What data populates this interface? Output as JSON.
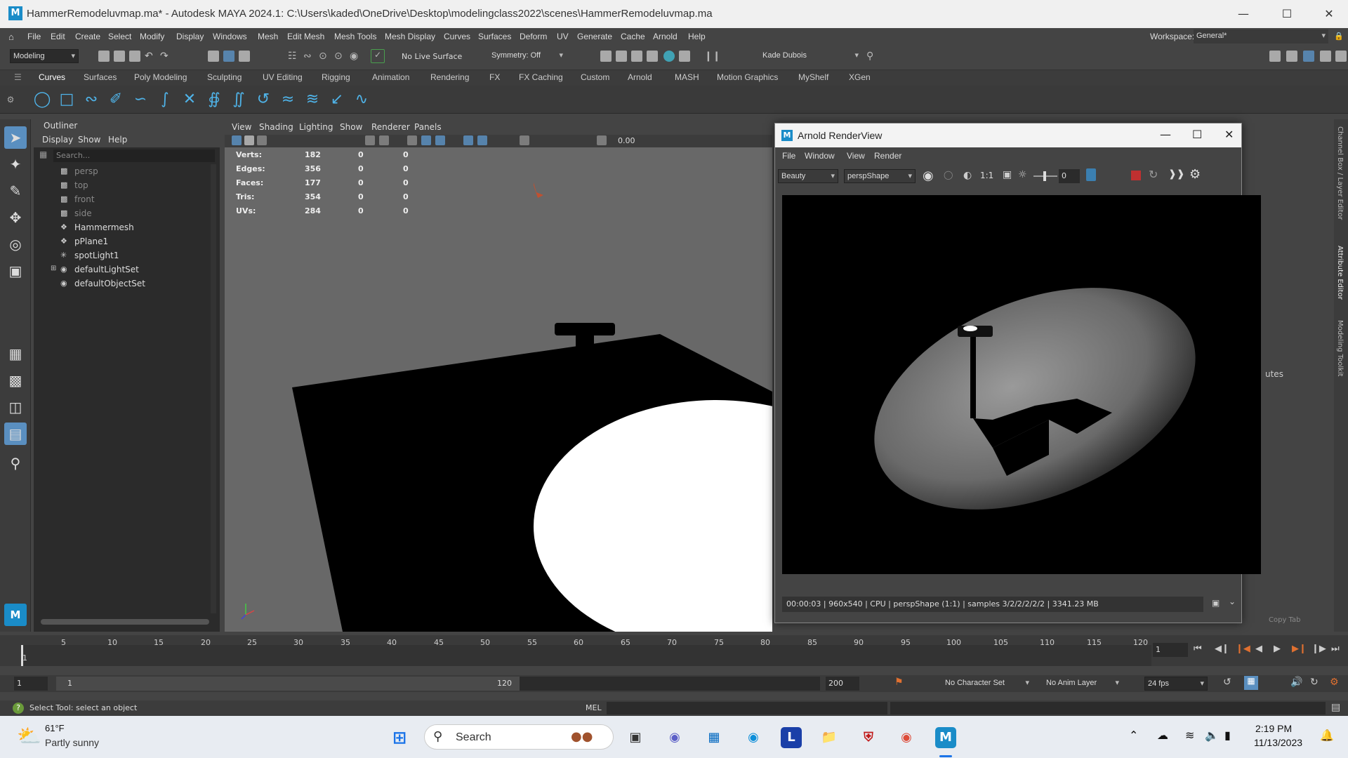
{
  "window": {
    "title": "HammerRemodeluvmap.ma* - Autodesk MAYA 2024.1: C:\\Users\\kaded\\OneDrive\\Desktop\\modelingclass2022\\scenes\\HammerRemodeluvmap.ma",
    "logo": "M"
  },
  "menubar": {
    "items": [
      "File",
      "Edit",
      "Create",
      "Select",
      "Modify",
      "Display",
      "Windows",
      "Mesh",
      "Edit Mesh",
      "Mesh Tools",
      "Mesh Display",
      "Curves",
      "Surfaces",
      "Deform",
      "UV",
      "Generate",
      "Cache",
      "Arnold",
      "Help"
    ],
    "workspace_label": "Workspace:",
    "workspace_value": "General*"
  },
  "statusline": {
    "mode": "Modeling",
    "live_surface": "No Live Surface",
    "symmetry": "Symmetry: Off",
    "user": "Kade Dubois"
  },
  "shelf": {
    "tabs": [
      "Curves",
      "Surfaces",
      "Poly Modeling",
      "Sculpting",
      "UV Editing",
      "Rigging",
      "Animation",
      "Rendering",
      "FX",
      "FX Caching",
      "Custom",
      "Arnold",
      "MASH",
      "Motion Graphics",
      "MyShelf",
      "XGen"
    ]
  },
  "outliner": {
    "title": "Outliner",
    "menu": [
      "Display",
      "Show",
      "Help"
    ],
    "search_placeholder": "Search...",
    "items": [
      {
        "label": "persp",
        "icon": "camera-icon",
        "dim": true
      },
      {
        "label": "top",
        "icon": "camera-icon",
        "dim": true
      },
      {
        "label": "front",
        "icon": "camera-icon",
        "dim": true
      },
      {
        "label": "side",
        "icon": "camera-icon",
        "dim": true
      },
      {
        "label": "Hammermesh",
        "icon": "mesh-icon",
        "dim": false
      },
      {
        "label": "pPlane1",
        "icon": "mesh-icon",
        "dim": false
      },
      {
        "label": "spotLight1",
        "icon": "spotlight-icon",
        "dim": false
      },
      {
        "label": "defaultLightSet",
        "icon": "set-icon",
        "dim": false
      },
      {
        "label": "defaultObjectSet",
        "icon": "set-icon",
        "dim": false
      }
    ]
  },
  "viewport": {
    "menu": [
      "View",
      "Shading",
      "Lighting",
      "Show",
      "Renderer",
      "Panels"
    ],
    "toolbar_value": "0.00",
    "hud": {
      "rows": [
        {
          "label": "Verts:",
          "a": "182",
          "b": "0",
          "c": "0"
        },
        {
          "label": "Edges:",
          "a": "356",
          "b": "0",
          "c": "0"
        },
        {
          "label": "Faces:",
          "a": "177",
          "b": "0",
          "c": "0"
        },
        {
          "label": "Tris:",
          "a": "354",
          "b": "0",
          "c": "0"
        },
        {
          "label": "UVs:",
          "a": "284",
          "b": "0",
          "c": "0"
        }
      ]
    }
  },
  "arnold": {
    "title": "Arnold RenderView",
    "logo": "M",
    "menu": [
      "File",
      "Window",
      "View",
      "Render"
    ],
    "aov": "Beauty",
    "camera": "perspShape",
    "ratio": "1:1",
    "exposure": "0",
    "status": "00:00:03 | 960x540 | CPU | perspShape (1:1) | samples 3/2/2/2/2/2 | 3341.23 MB"
  },
  "rightpanel": {
    "partial_text": "utes",
    "copy_tab": "Copy Tab",
    "vertical_tabs": [
      "Channel Box / Layer Editor",
      "Attribute Editor",
      "Modeling Toolkit"
    ]
  },
  "timeslider": {
    "ticks": [
      "1",
      "5",
      "10",
      "15",
      "20",
      "25",
      "30",
      "35",
      "40",
      "45",
      "50",
      "55",
      "60",
      "65",
      "70",
      "75",
      "80",
      "85",
      "90",
      "95",
      "100",
      "105",
      "110",
      "115",
      "120"
    ],
    "current_frame": "1"
  },
  "rangeslider": {
    "start": "1",
    "range_start": "1",
    "range_end": "120",
    "end": "200",
    "character_set": "No Character Set",
    "anim_layer": "No Anim Layer",
    "fps": "24 fps"
  },
  "cmdline": {
    "help": "Select Tool: select an object",
    "lang": "MEL"
  },
  "taskbar": {
    "weather_temp": "61°F",
    "weather_desc": "Partly sunny",
    "search_label": "Search",
    "time": "2:19 PM",
    "date": "11/13/2023"
  }
}
